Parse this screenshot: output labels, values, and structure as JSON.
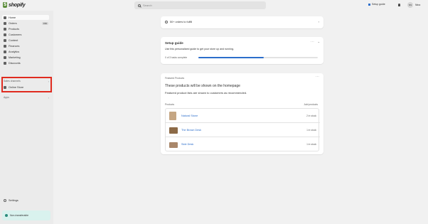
{
  "topbar": {
    "logo_text": "shopify",
    "search_placeholder": "Search",
    "setup_label": "Setup guide",
    "avatar_initials": "NS",
    "store_name": "Nina"
  },
  "sidebar": {
    "items": [
      {
        "label": "Home",
        "icon": "home-icon"
      },
      {
        "label": "Orders",
        "icon": "orders-icon",
        "badge": "150"
      },
      {
        "label": "Products",
        "icon": "tag-icon"
      },
      {
        "label": "Customers",
        "icon": "person-icon"
      },
      {
        "label": "Content",
        "icon": "content-icon"
      },
      {
        "label": "Finances",
        "icon": "bank-icon"
      },
      {
        "label": "Analytics",
        "icon": "chart-icon"
      },
      {
        "label": "Marketing",
        "icon": "target-icon"
      },
      {
        "label": "Discounts",
        "icon": "discount-icon"
      }
    ],
    "sales_channels_label": "Sales channels",
    "online_store_label": "Online Store",
    "apps_label": "Apps",
    "settings_label": "Settings",
    "nontransferable_label": "Non-transferable"
  },
  "main": {
    "search_card_text": "50+ orders to fulfill",
    "setup": {
      "title": "Setup guide",
      "desc": "Use this personalized guide to get your store up and running.",
      "progress_label": "0 of 3 tasks complete",
      "progress": 0.55
    },
    "featured": {
      "eyebrow": "Featured Products",
      "headline": "These products will be shown on the homepage",
      "sub": "Featured product lists are shown to customers as recommended.",
      "products_label": "Products",
      "add_label": "Add products",
      "products": [
        {
          "name": "Natural Stone",
          "stock": "2 in stock"
        },
        {
          "name": "The Brown Desk",
          "stock": "1 in stock"
        },
        {
          "name": "Side Desk",
          "stock": "1 in stock"
        }
      ]
    }
  }
}
